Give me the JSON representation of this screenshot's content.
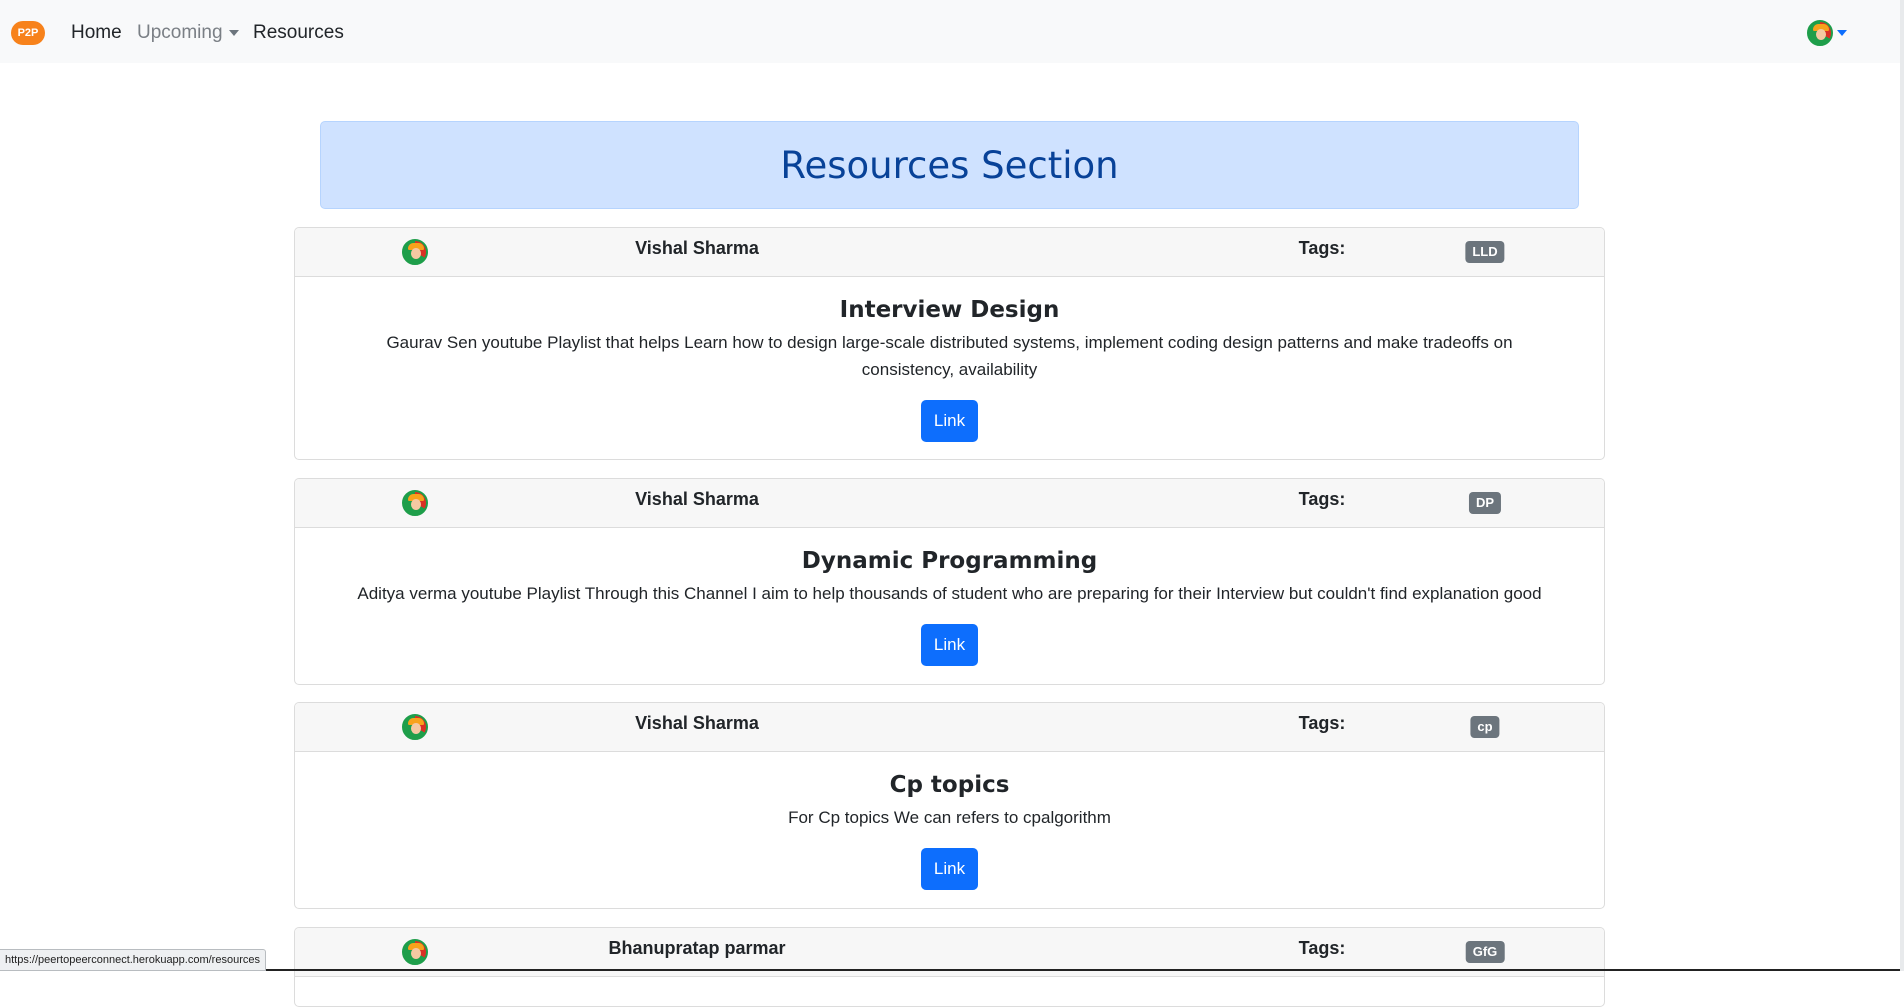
{
  "nav": {
    "brand": "P2P",
    "home": "Home",
    "upcoming": "Upcoming",
    "resources": "Resources"
  },
  "header": {
    "title": "Resources Section"
  },
  "labels": {
    "tags": "Tags:",
    "link": "Link"
  },
  "resources": [
    {
      "author": "Vishal Sharma",
      "tag": "LLD",
      "title": "Interview Design",
      "description": "Gaurav Sen youtube Playlist that helps Learn how to design large-scale distributed systems, implement coding design patterns and make tradeoffs on consistency, availability"
    },
    {
      "author": "Vishal Sharma",
      "tag": "DP",
      "title": "Dynamic Programming",
      "description": "Aditya verma youtube Playlist Through this Channel I aim to help thousands of student who are preparing for their Interview but couldn't find explanation good"
    },
    {
      "author": "Vishal Sharma",
      "tag": "cp",
      "title": "Cp topics",
      "description": "For Cp topics We can refers to cpalgorithm"
    },
    {
      "author": "Bhanupratap parmar",
      "tag": "GfG"
    }
  ],
  "status_bar": {
    "url": "https://peertopeerconnect.herokuapp.com/resources"
  },
  "colors": {
    "header_bg": "#cfe2ff",
    "header_text": "#084298",
    "button": "#0d6efd",
    "badge": "#6c757d",
    "brand": "#f7821b"
  },
  "icons": {
    "avatar": "user-avatar-icon",
    "caret": "caret-down-icon"
  }
}
